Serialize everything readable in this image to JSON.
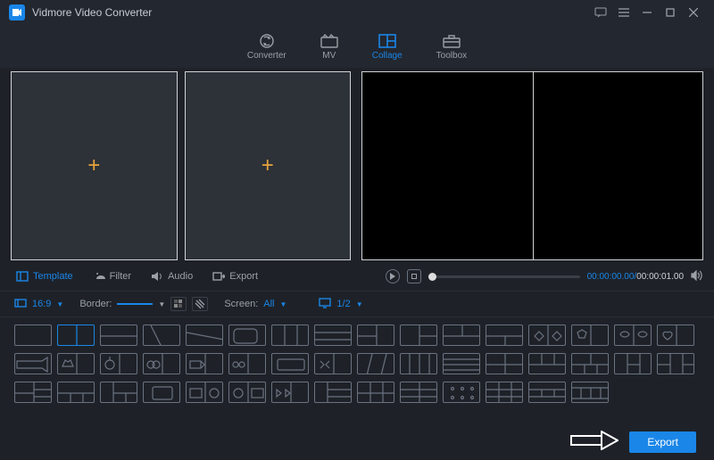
{
  "app": {
    "title": "Vidmore Video Converter"
  },
  "nav": {
    "converter": "Converter",
    "mv": "MV",
    "collage": "Collage",
    "toolbox": "Toolbox"
  },
  "tabs": {
    "template": "Template",
    "filter": "Filter",
    "audio": "Audio",
    "export": "Export"
  },
  "playback": {
    "current": "00:00:00.00",
    "total": "00:00:01.00"
  },
  "options": {
    "aspect_value": "16:9",
    "border_label": "Border:",
    "screen_label": "Screen:",
    "screen_value": "All",
    "page": "1/2"
  },
  "footer": {
    "export": "Export"
  }
}
